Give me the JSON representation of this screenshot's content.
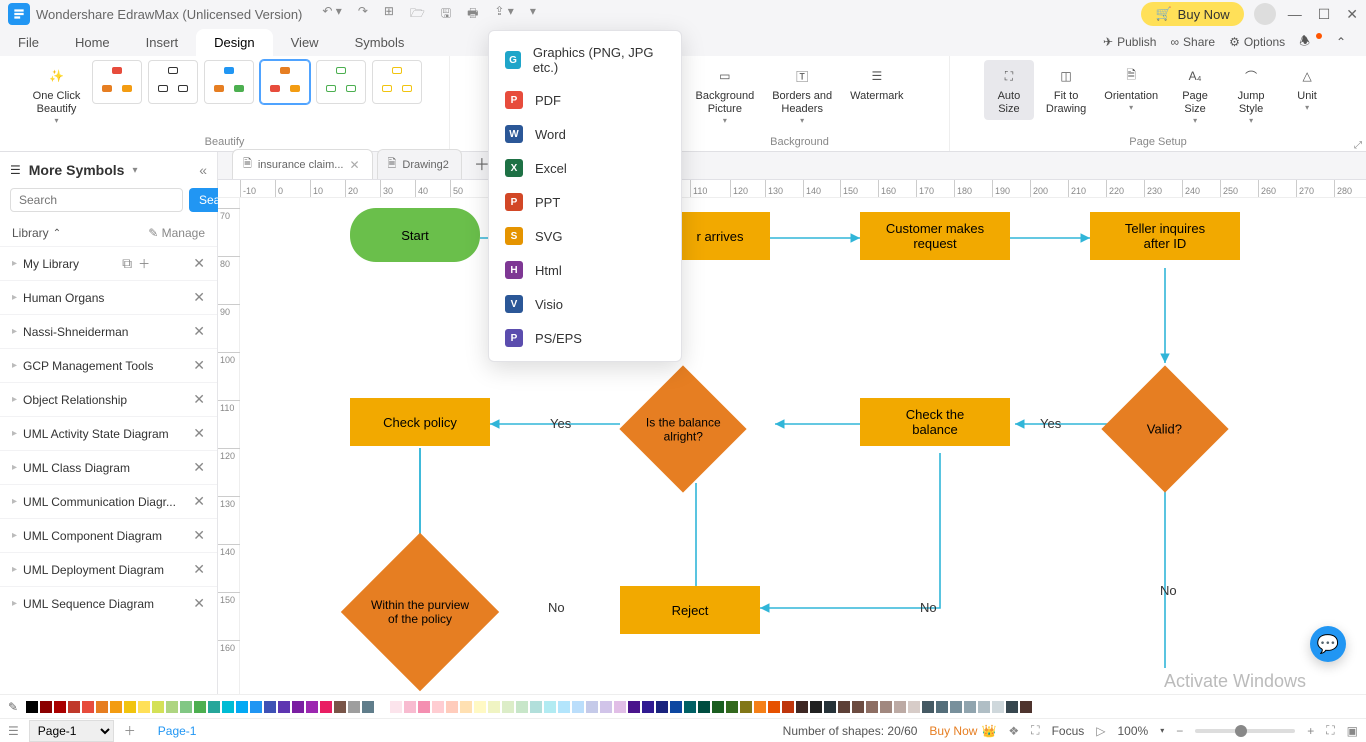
{
  "titlebar": {
    "app_name": "Wondershare EdrawMax (Unlicensed Version)",
    "buy_now": "Buy Now"
  },
  "menus": {
    "file": "File",
    "home": "Home",
    "insert": "Insert",
    "design": "Design",
    "view": "View",
    "symbols": "Symbols",
    "publish": "Publish",
    "share": "Share",
    "options": "Options"
  },
  "ribbon": {
    "one_click_beautify": "One Click\nBeautify",
    "beautify_group": "Beautify",
    "background_picture": "Background\nPicture",
    "borders_headers": "Borders and\nHeaders",
    "watermark": "Watermark",
    "background_group": "Background",
    "auto_size": "Auto\nSize",
    "fit_drawing": "Fit to\nDrawing",
    "orientation": "Orientation",
    "page_size": "Page\nSize",
    "jump_style": "Jump\nStyle",
    "unit": "Unit",
    "page_setup_group": "Page Setup"
  },
  "export_menu": [
    {
      "label": "Graphics (PNG, JPG etc.)",
      "color": "#1fa5c9",
      "abbr": "G"
    },
    {
      "label": "PDF",
      "color": "#e74c3c",
      "abbr": "P"
    },
    {
      "label": "Word",
      "color": "#2b5797",
      "abbr": "W"
    },
    {
      "label": "Excel",
      "color": "#1e7145",
      "abbr": "X"
    },
    {
      "label": "PPT",
      "color": "#d24726",
      "abbr": "P"
    },
    {
      "label": "SVG",
      "color": "#e59400",
      "abbr": "S"
    },
    {
      "label": "Html",
      "color": "#7e3794",
      "abbr": "H"
    },
    {
      "label": "Visio",
      "color": "#2b5797",
      "abbr": "V"
    },
    {
      "label": "PS/EPS",
      "color": "#5b4dae",
      "abbr": "P"
    }
  ],
  "left_panel": {
    "title": "More Symbols",
    "search_placeholder": "Search",
    "search_btn": "Search",
    "library_label": "Library",
    "manage_label": "Manage",
    "items": [
      "My Library",
      "Human Organs",
      "Nassi-Shneiderman",
      "GCP Management Tools",
      "Object Relationship",
      "UML Activity State Diagram",
      "UML Class Diagram",
      "UML Communication Diagr...",
      "UML Component Diagram",
      "UML Deployment Diagram",
      "UML Sequence Diagram"
    ]
  },
  "doc_tabs": {
    "tab1": "insurance claim...",
    "tab2": "Drawing2"
  },
  "ruler_h": [
    "-10",
    "0",
    "10",
    "20",
    "30",
    "40",
    "50",
    "110",
    "120",
    "130",
    "140",
    "150",
    "160",
    "170",
    "180",
    "190",
    "200",
    "210",
    "220",
    "230",
    "240",
    "250",
    "260",
    "270",
    "280"
  ],
  "ruler_v": [
    "70",
    "80",
    "90",
    "100",
    "110",
    "120",
    "130",
    "140",
    "150",
    "160"
  ],
  "shapes": {
    "start": "Start",
    "arrives": "r arrives",
    "makes_request": "Customer makes\nrequest",
    "teller_inquires": "Teller inquires\nafter ID",
    "check_policy": "Check policy",
    "balance_alright": "Is the balance\nalright?",
    "check_balance": "Check the\nbalance",
    "valid": "Valid?",
    "within_purview": "Within the purview\nof the policy",
    "reject": "Reject"
  },
  "labels": {
    "yes1": "Yes",
    "yes2": "Yes",
    "no1": "No",
    "no2": "No",
    "no3": "No"
  },
  "colors": [
    "#000",
    "#8b0000",
    "#a00",
    "#c0392b",
    "#e74c3c",
    "#e67e22",
    "#f39c12",
    "#f1c40f",
    "#ffe058",
    "#d4e157",
    "#aed581",
    "#81c784",
    "#4caf50",
    "#26a69a",
    "#00bcd4",
    "#03a9f4",
    "#2196f3",
    "#3f51b5",
    "#5e35b1",
    "#7b1fa2",
    "#9c27b0",
    "#e91e63",
    "#795548",
    "#9e9e9e",
    "#607d8b",
    "#fff",
    "#fce4ec",
    "#f8bbd0",
    "#f48fb1",
    "#ffcdd2",
    "#ffccbc",
    "#ffe0b2",
    "#fff9c4",
    "#f0f4c3",
    "#dcedc8",
    "#c8e6c9",
    "#b2dfdb",
    "#b2ebf2",
    "#b3e5fc",
    "#bbdefb",
    "#c5cae9",
    "#d1c4e9",
    "#e1bee7",
    "#4a148c",
    "#311b92",
    "#1a237e",
    "#0d47a1",
    "#006064",
    "#004d40",
    "#1b5e20",
    "#33691e",
    "#827717",
    "#f57f17",
    "#e65100",
    "#bf360c",
    "#3e2723",
    "#212121",
    "#263238",
    "#5d4037",
    "#6d4c41",
    "#8d6e63",
    "#a1887f",
    "#bcaaa4",
    "#d7ccc8",
    "#455a64",
    "#546e7a",
    "#78909c",
    "#90a4ae",
    "#b0bec5",
    "#cfd8dc",
    "#37474f",
    "#4e342e"
  ],
  "status": {
    "page_selector": "Page-1",
    "page_tab": "Page-1",
    "shapes_count": "Number of shapes: 20/60",
    "buy_now": "Buy Now",
    "focus": "Focus",
    "zoom": "100%"
  },
  "watermark_text": "Activate Windows"
}
